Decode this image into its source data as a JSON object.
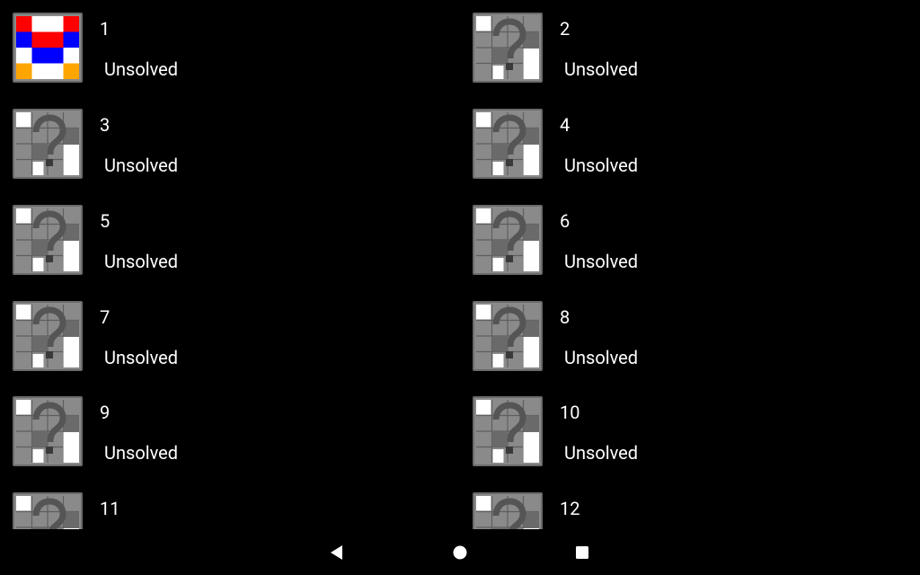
{
  "levels": [
    {
      "number": "1",
      "status": "Unsolved",
      "thumbnail": "solved-pattern-thumbnail"
    },
    {
      "number": "2",
      "status": "Unsolved",
      "thumbnail": "question-mark-thumbnail"
    },
    {
      "number": "3",
      "status": "Unsolved",
      "thumbnail": "question-mark-thumbnail"
    },
    {
      "number": "4",
      "status": "Unsolved",
      "thumbnail": "question-mark-thumbnail"
    },
    {
      "number": "5",
      "status": "Unsolved",
      "thumbnail": "question-mark-thumbnail"
    },
    {
      "number": "6",
      "status": "Unsolved",
      "thumbnail": "question-mark-thumbnail"
    },
    {
      "number": "7",
      "status": "Unsolved",
      "thumbnail": "question-mark-thumbnail"
    },
    {
      "number": "8",
      "status": "Unsolved",
      "thumbnail": "question-mark-thumbnail"
    },
    {
      "number": "9",
      "status": "Unsolved",
      "thumbnail": "question-mark-thumbnail"
    },
    {
      "number": "10",
      "status": "Unsolved",
      "thumbnail": "question-mark-thumbnail"
    },
    {
      "number": "11",
      "status": "",
      "thumbnail": "question-mark-thumbnail"
    },
    {
      "number": "12",
      "status": "",
      "thumbnail": "question-mark-thumbnail"
    }
  ],
  "nav": {
    "back_icon": "back-triangle-icon",
    "home_icon": "home-circle-icon",
    "recents_icon": "recents-square-icon"
  },
  "colors": {
    "background": "#000000",
    "text": "#ffffff",
    "tile_gray": "#8a8a8a",
    "tile_dark": "#555555",
    "red": "#ff0000",
    "blue": "#0000ff",
    "orange": "#ffa500",
    "white": "#ffffff"
  }
}
